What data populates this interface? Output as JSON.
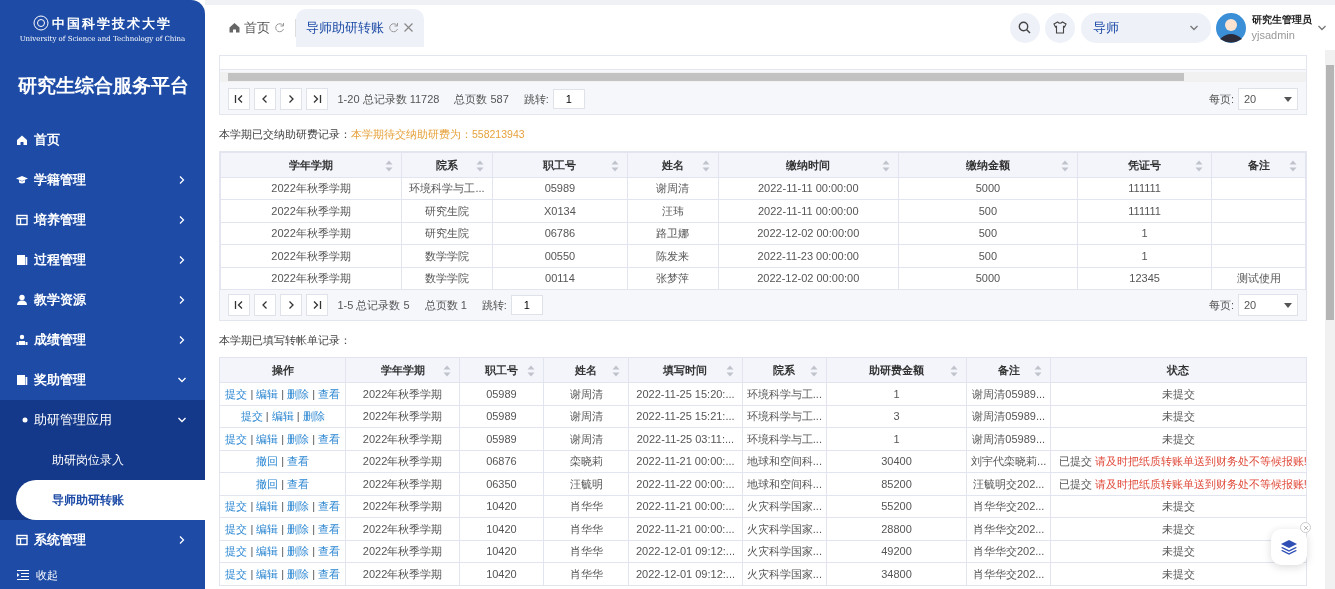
{
  "sidebar": {
    "logo_text": "中国科学技术大学",
    "logo_subtext": "University of Science and Technology of China",
    "title": "研究生综合服务平台",
    "items": [
      {
        "label": "首页",
        "kind": "link",
        "selected": false
      },
      {
        "label": "学籍管理",
        "kind": "group",
        "expanded": false
      },
      {
        "label": "培养管理",
        "kind": "group",
        "expanded": false
      },
      {
        "label": "过程管理",
        "kind": "group",
        "expanded": false
      },
      {
        "label": "教学资源",
        "kind": "group",
        "expanded": false
      },
      {
        "label": "成绩管理",
        "kind": "group",
        "expanded": false
      },
      {
        "label": "奖助管理",
        "kind": "group",
        "expanded": true,
        "children": [
          {
            "label": "助研管理应用",
            "kind": "group",
            "expanded": true,
            "children": [
              {
                "label": "助研岗位录入",
                "kind": "link",
                "selected": false
              },
              {
                "label": "导师助研转账",
                "kind": "link",
                "selected": true
              }
            ]
          }
        ]
      },
      {
        "label": "系统管理",
        "kind": "group",
        "expanded": false
      }
    ],
    "collapse_label": "收起"
  },
  "tabs": [
    {
      "label": "首页",
      "selected": false,
      "closable": false
    },
    {
      "label": "导师助研转账",
      "selected": true,
      "closable": true
    }
  ],
  "header": {
    "role": "导师",
    "user_name": "研究生管理员",
    "user_id": "yjsadmin"
  },
  "top_pager": {
    "range": "1-20 总记录数 11728",
    "pages": "总页数 587",
    "jump_label": "跳转:",
    "jump_value": "1",
    "per_page_label": "每页:",
    "per_page": "20"
  },
  "paid_section": {
    "caption": "本学期已交纳助研费记录：",
    "due_note": "本学期待交纳助研费为：558213943",
    "columns": [
      {
        "label": "学年学期",
        "sortable": true
      },
      {
        "label": "院系",
        "sortable": true
      },
      {
        "label": "职工号",
        "sortable": true
      },
      {
        "label": "姓名",
        "sortable": true
      },
      {
        "label": "缴纳时间",
        "sortable": true
      },
      {
        "label": "缴纳金额",
        "sortable": true
      },
      {
        "label": "凭证号",
        "sortable": true
      },
      {
        "label": "备注",
        "sortable": true
      }
    ],
    "rows": [
      [
        "2022年秋季学期",
        "环境科学与工...",
        "05989",
        "谢周清",
        "2022-11-11 00:00:00",
        "5000",
        "111111",
        ""
      ],
      [
        "2022年秋季学期",
        "研究生院",
        "X0134",
        "汪玮",
        "2022-11-11 00:00:00",
        "500",
        "111111",
        ""
      ],
      [
        "2022年秋季学期",
        "研究生院",
        "06786",
        "路卫娜",
        "2022-12-02 00:00:00",
        "500",
        "1",
        ""
      ],
      [
        "2022年秋季学期",
        "数学学院",
        "00550",
        "陈发来",
        "2022-11-23 00:00:00",
        "500",
        "1",
        ""
      ],
      [
        "2022年秋季学期",
        "数学学院",
        "00114",
        "张梦萍",
        "2022-12-02 00:00:00",
        "5000",
        "12345",
        "测试使用"
      ]
    ],
    "pager": {
      "range": "1-5 总记录数 5",
      "pages": "总页数 1",
      "jump_label": "跳转:",
      "jump_value": "1",
      "per_page_label": "每页:",
      "per_page": "20"
    }
  },
  "transfer_section": {
    "caption": "本学期已填写转帐单记录：",
    "action_separator": "|",
    "columns": [
      {
        "label": "操作",
        "sortable": false
      },
      {
        "label": "学年学期",
        "sortable": true
      },
      {
        "label": "职工号",
        "sortable": true
      },
      {
        "label": "姓名",
        "sortable": true
      },
      {
        "label": "填写时间",
        "sortable": true
      },
      {
        "label": "院系",
        "sortable": true
      },
      {
        "label": "助研费金额",
        "sortable": true
      },
      {
        "label": "备注",
        "sortable": true
      },
      {
        "label": "状态",
        "sortable": false
      }
    ],
    "rows": [
      [
        [
          "提交",
          "编辑",
          "删除",
          "查看"
        ],
        "2022年秋季学期",
        "05989",
        "谢周清",
        "2022-11-25 15:20:...",
        "环境科学与工...",
        "1",
        "谢周清05989...",
        {
          "status": "未提交"
        }
      ],
      [
        [
          "提交",
          "编辑",
          "删除"
        ],
        "2022年秋季学期",
        "05989",
        "谢周清",
        "2022-11-25 15:21:...",
        "环境科学与工...",
        "3",
        "谢周清05989...",
        {
          "status": "未提交"
        }
      ],
      [
        [
          "提交",
          "编辑",
          "删除",
          "查看"
        ],
        "2022年秋季学期",
        "05989",
        "谢周清",
        "2022-11-25 03:11:...",
        "环境科学与工...",
        "1",
        "谢周清05989...",
        {
          "status": "未提交"
        }
      ],
      [
        [
          "撤回",
          "查看"
        ],
        "2022年秋季学期",
        "06876",
        "栾晓莉",
        "2022-11-21 00:00:...",
        "地球和空间科...",
        "30400",
        "刘宇代栾晓莉...",
        {
          "status": "已提交",
          "warning": "请及时把纸质转账单送到财务处不等候报账!"
        }
      ],
      [
        [
          "撤回",
          "查看"
        ],
        "2022年秋季学期",
        "06350",
        "汪毓明",
        "2022-11-22 00:00:...",
        "地球和空间科...",
        "85200",
        "汪毓明交202...",
        {
          "status": "已提交",
          "warning": "请及时把纸质转账单送到财务处不等候报账!"
        }
      ],
      [
        [
          "提交",
          "编辑",
          "删除",
          "查看"
        ],
        "2022年秋季学期",
        "10420",
        "肖华华",
        "2022-11-21 00:00:...",
        "火灾科学国家...",
        "55200",
        "肖华华交202...",
        {
          "status": "未提交"
        }
      ],
      [
        [
          "提交",
          "编辑",
          "删除",
          "查看"
        ],
        "2022年秋季学期",
        "10420",
        "肖华华",
        "2022-11-21 00:00:...",
        "火灾科学国家...",
        "28800",
        "肖华华交202...",
        {
          "status": "未提交"
        }
      ],
      [
        [
          "提交",
          "编辑",
          "删除",
          "查看"
        ],
        "2022年秋季学期",
        "10420",
        "肖华华",
        "2022-12-01 09:12:...",
        "火灾科学国家...",
        "49200",
        "肖华华交202...",
        {
          "status": "未提交"
        }
      ],
      [
        [
          "提交",
          "编辑",
          "删除",
          "查看"
        ],
        "2022年秋季学期",
        "10420",
        "肖华华",
        "2022-12-01 09:12:...",
        "火灾科学国家...",
        "34800",
        "肖华华交202...",
        {
          "status": "未提交"
        }
      ]
    ]
  }
}
